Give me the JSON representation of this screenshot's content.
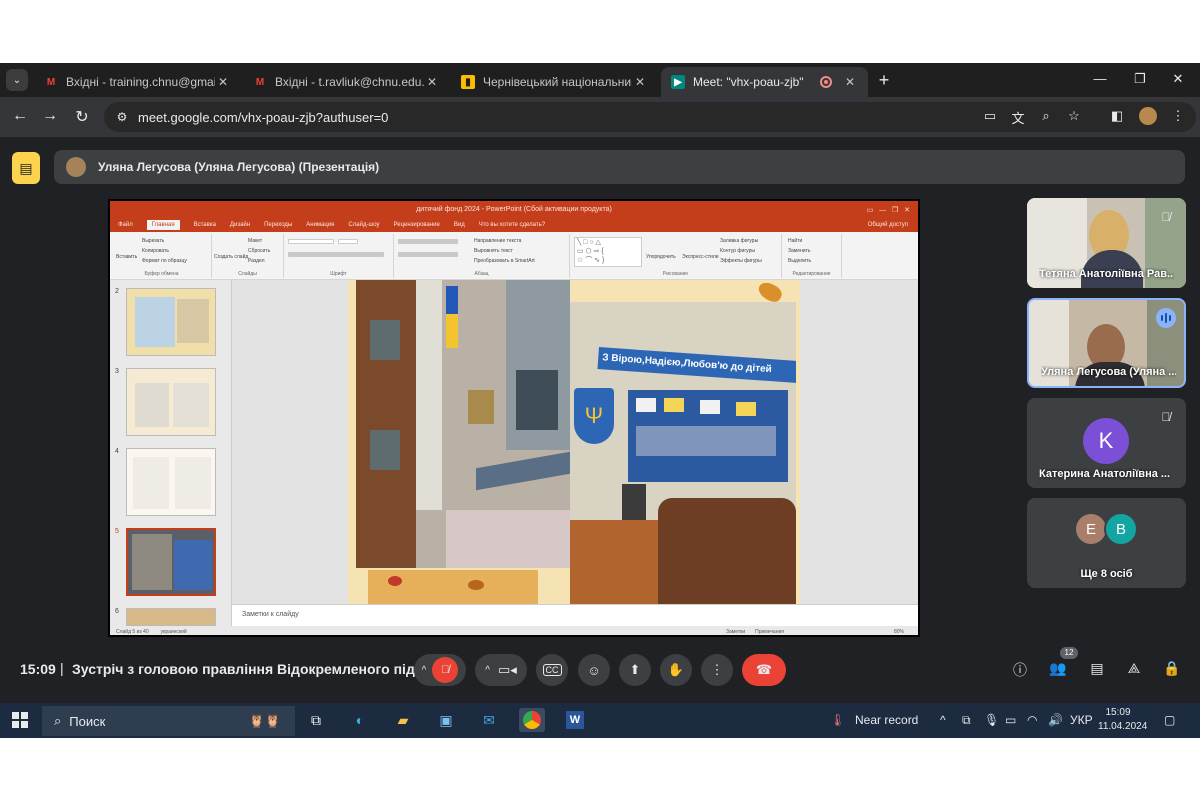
{
  "browser": {
    "tabs": [
      {
        "title": "Вхідні - training.chnu@gmail.com",
        "favicon": "gmail-icon"
      },
      {
        "title": "Вхідні - t.ravliuk@chnu.edu.ua",
        "favicon": "gmail-icon"
      },
      {
        "title": "Чернівецький національний у",
        "favicon": "classroom-icon"
      },
      {
        "title": "Meet: \"vhx-poau-zjb\"",
        "favicon": "meet-icon",
        "active": true,
        "recording": true
      }
    ],
    "url": "meet.google.com/vhx-poau-zjb?authuser=0"
  },
  "presenter": {
    "label": "Уляна Легусова (Уляна Легусова) (Презентація)"
  },
  "powerpoint": {
    "window_title": "дитячий фонд 2024 - PowerPoint (Сбой активации продукта)",
    "tabs": [
      "Файл",
      "Главная",
      "Вставка",
      "Дизайн",
      "Переходы",
      "Анимация",
      "Слайд-шоу",
      "Рецензирование",
      "Вид",
      "Что вы хотите сделать?"
    ],
    "selected_tab": "Главная",
    "share_label": "Общий доступ",
    "ribbon": {
      "clipboard": {
        "paste": "Вставить",
        "cut": "Вырезать",
        "copy": "Копировать",
        "format": "Формат по образцу",
        "group": "Буфер обмена"
      },
      "slides": {
        "create": "Создать слайд",
        "layout": "Макет",
        "reset": "Сбросить",
        "section": "Раздел",
        "group": "Слайды"
      },
      "font_group": "Шрифт",
      "paragraph": {
        "direction": "Направление текста",
        "align": "Выровнять текст",
        "smartart": "Преобразовать в SmartArt",
        "group": "Абзац"
      },
      "drawing": {
        "arrange": "Упорядочить",
        "styles": "Экспресс-стили",
        "fill": "Заливка фигуры",
        "outline": "Контур фигуры",
        "effects": "Эффекты фигуры",
        "group": "Рисование"
      },
      "editing": {
        "find": "Найти",
        "replace": "Заменить",
        "select": "Выделить",
        "group": "Редактирование"
      }
    },
    "thumbnail_numbers": [
      "2",
      "3",
      "4",
      "5",
      "6"
    ],
    "selected_slide": "5",
    "notes_placeholder": "Заметки к слайду",
    "status_left": "Слайд 5 из 40",
    "status_lang": "украинский",
    "status_notes": "Заметки",
    "status_comments": "Примечания",
    "zoom": "80%",
    "slide_banner": "З Вірою,Надією,Любов'ю до дітей"
  },
  "participants": [
    {
      "name": "Тетяна Анатоліївна Рав...",
      "muted": true,
      "type": "video"
    },
    {
      "name": "Уляна Легусова (Уляна ...",
      "muted": false,
      "speaking": true,
      "type": "video"
    },
    {
      "name": "Катерина Анатоліївна ...",
      "muted": true,
      "type": "avatar",
      "initial": "K",
      "color": "#7b4fd6"
    },
    {
      "name": "Ще 8 осіб",
      "type": "group",
      "initials": [
        "E",
        "B"
      ],
      "colors": [
        "#a97e6a",
        "#12a5a2"
      ]
    }
  ],
  "meeting": {
    "time": "15:09",
    "separator": "|",
    "title": "Зустріч з головою правління Відокремленого підр...",
    "people_count": "12"
  },
  "taskbar": {
    "search_placeholder": "Поиск",
    "weather": "Near record",
    "language": "УКР",
    "time": "15:09",
    "date": "11.04.2024"
  },
  "colors": {
    "meet_bg": "#202124",
    "tile_bg": "#3c4043",
    "end_call": "#ea4335",
    "present_icon": "#fcd34d",
    "powerpoint_accent": "#c43e1c",
    "taskbar": "#1c2b3f"
  }
}
